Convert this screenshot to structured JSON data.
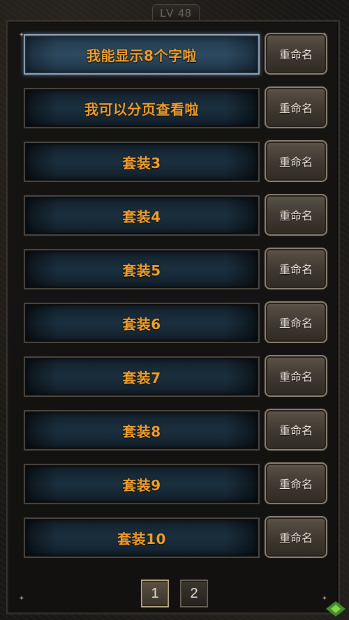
{
  "header": {
    "level_label": "LV 48"
  },
  "slots": [
    {
      "name": "我能显示8个字啦",
      "selected": true
    },
    {
      "name": "我可以分页查看啦",
      "selected": false
    },
    {
      "name": "套装3",
      "selected": false
    },
    {
      "name": "套装4",
      "selected": false
    },
    {
      "name": "套装5",
      "selected": false
    },
    {
      "name": "套装6",
      "selected": false
    },
    {
      "name": "套装7",
      "selected": false
    },
    {
      "name": "套装8",
      "selected": false
    },
    {
      "name": "套装9",
      "selected": false
    },
    {
      "name": "套装10",
      "selected": false
    }
  ],
  "rename_label": "重命名",
  "pagination": {
    "pages": [
      "1",
      "2"
    ],
    "current": "1"
  },
  "colors": {
    "slot_text": "#f0a030",
    "button_text": "#f4ece0"
  }
}
